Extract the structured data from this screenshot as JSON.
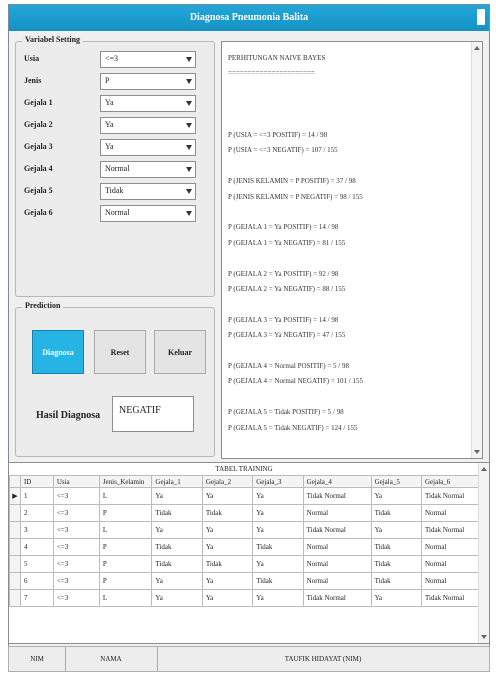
{
  "window": {
    "title": "Diagnosa Pneumonia Balita"
  },
  "variable_setting": {
    "title": "Variabel Setting",
    "rows": [
      {
        "label": "Usia",
        "value": "<=3"
      },
      {
        "label": "Jenis",
        "value": "P"
      },
      {
        "label": "Gejala 1",
        "value": "Ya"
      },
      {
        "label": "Gejala 2",
        "value": "Ya"
      },
      {
        "label": "Gejala 3",
        "value": "Ya"
      },
      {
        "label": "Gejala 4",
        "value": "Normal"
      },
      {
        "label": "Gejala 5",
        "value": "Tidak"
      },
      {
        "label": "Gejala 6",
        "value": "Normal"
      }
    ]
  },
  "prediction": {
    "title": "Prediction",
    "diagnosa_label": "Diagnosa",
    "reset_label": "Reset",
    "keluar_label": "Keluar",
    "hasil_label": "Hasil Diagnosa",
    "hasil_value": "NEGATIF"
  },
  "output": {
    "lines": [
      "PERHITUNGAN NAIVE BAYES",
      "======================",
      "",
      "",
      "",
      "P (USIA = <=3 POSITIF) = 14 / 98",
      "P (USIA = <=3 NEGATIF) = 107 / 155",
      "",
      "P (JENIS KELAMIN = P POSITIF) = 37 / 98",
      "P (JENIS KELAMIN = P NEGATIF) = 98 / 155",
      "",
      "P (GEJALA 1 = Ya POSITIF) = 14 / 98",
      "P (GEJALA 1 = Ya NEGATIF) = 81 / 155",
      "",
      "P (GEJALA 2 = Ya POSITIF) = 92 / 98",
      "P (GEJALA 2 = Ya NEGATIF) = 88 / 155",
      "",
      "P (GEJALA 3 = Ya POSITIF) = 14 / 98",
      "P (GEJALA 3 = Ya NEGATIF) = 47 / 155",
      "",
      "P (GEJALA 4 = Normal POSITIF) = 5 / 98",
      "P (GEJALA 4 = Normal NEGATIF) = 101 / 155",
      "",
      "P (GEJALA 5 = Tidak POSITIF) = 5 / 98",
      "P (GEJALA 5 = Tidak NEGATIF) = 124 / 155"
    ]
  },
  "table": {
    "caption": "TABEL TRAINING",
    "columns": [
      "ID",
      "Usia",
      "Jenis_Kelamin",
      "Gejala_1",
      "Gejala_2",
      "Gejala_3",
      "Gejala_4",
      "Gejala_5",
      "Gejala_6"
    ],
    "rows": [
      [
        "1",
        "<=3",
        "L",
        "Ya",
        "Ya",
        "Ya",
        "Tidak Normal",
        "Ya",
        "Tidak Normal"
      ],
      [
        "2",
        "<=3",
        "P",
        "Tidak",
        "Tidak",
        "Ya",
        "Normal",
        "Tidak",
        "Normal"
      ],
      [
        "3",
        "<=3",
        "L",
        "Ya",
        "Ya",
        "Ya",
        "Tidak Normal",
        "Ya",
        "Tidak Normal"
      ],
      [
        "4",
        "<=3",
        "P",
        "Tidak",
        "Ya",
        "Tidak",
        "Normal",
        "Tidak",
        "Normal"
      ],
      [
        "5",
        "<=3",
        "P",
        "Tidak",
        "Tidak",
        "Ya",
        "Normal",
        "Tidak",
        "Normal"
      ],
      [
        "6",
        "<=3",
        "P",
        "Ya",
        "Ya",
        "Tidak",
        "Normal",
        "Tidak",
        "Normal"
      ],
      [
        "7",
        "<=3",
        "L",
        "Ya",
        "Ya",
        "Ya",
        "Tidak Normal",
        "Ya",
        "Tidak Normal"
      ]
    ]
  },
  "status": {
    "cell1": "NIM",
    "cell2": "NAMA",
    "cell3": "TAUFIK HIDAYAT (NIM)"
  },
  "colors": {
    "title_bar": "#1592c4",
    "primary_button": "#25b4e4"
  }
}
